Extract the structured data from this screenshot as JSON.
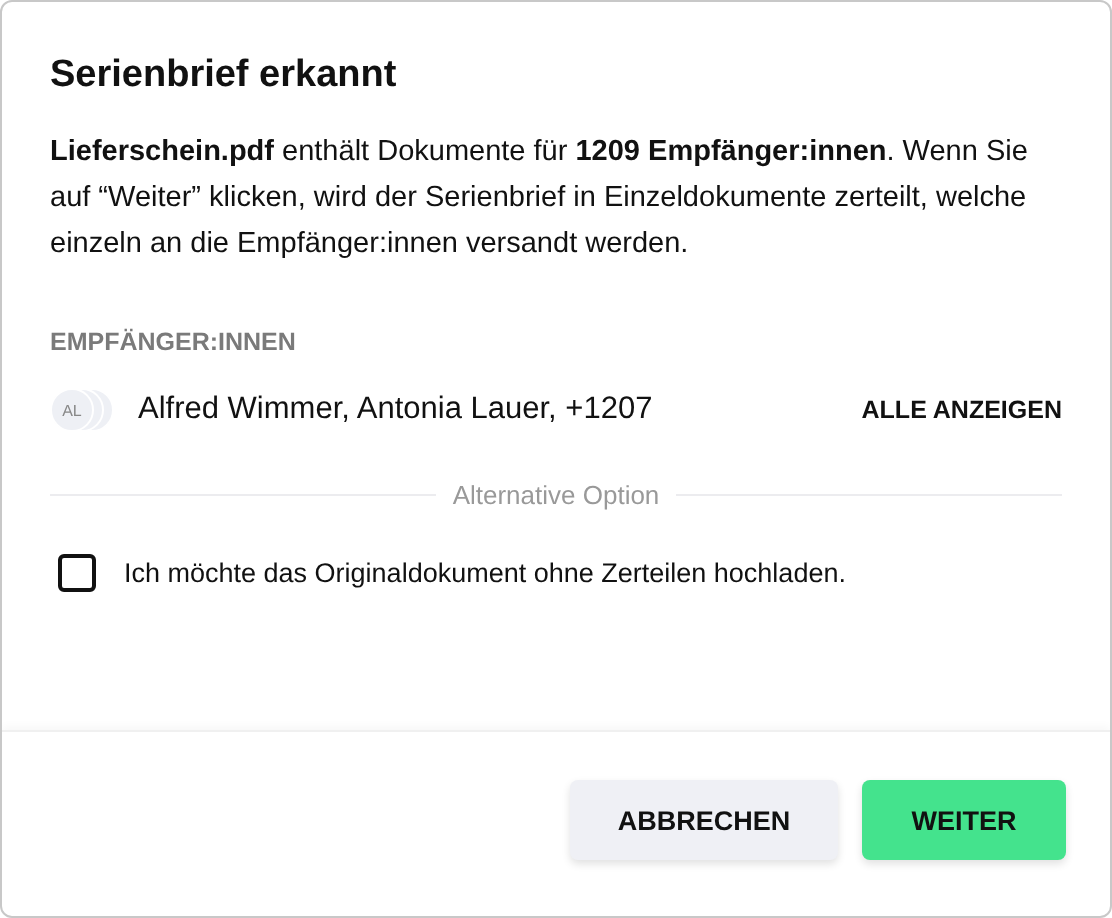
{
  "dialog": {
    "title": "Serienbrief erkannt",
    "message": "**Lieferschein.pdf** enthält Dokumente für **1209 Empfänger:innen**. Wenn Sie auf “Weiter” klicken, wird der Serienbrief in Einzeldokumente zerteilt, welche einzeln an die Empfänger:innen versandt werden.",
    "recipients": {
      "heading": "EMPFÄNGER:INNEN",
      "avatar_initials": "AL",
      "names": "Alfred Wimmer, Antonia Lauer, +1207",
      "show_all": "ALLE ANZEIGEN"
    },
    "divider_label": "Alternative Option",
    "option": {
      "label": "Ich möchte das Originaldokument ohne Zerteilen hochladen.",
      "checked": false
    },
    "buttons": [
      {
        "label": "ABBRECHEN",
        "kind": "secondary"
      },
      {
        "label": "WEITER",
        "kind": "primary"
      }
    ]
  }
}
